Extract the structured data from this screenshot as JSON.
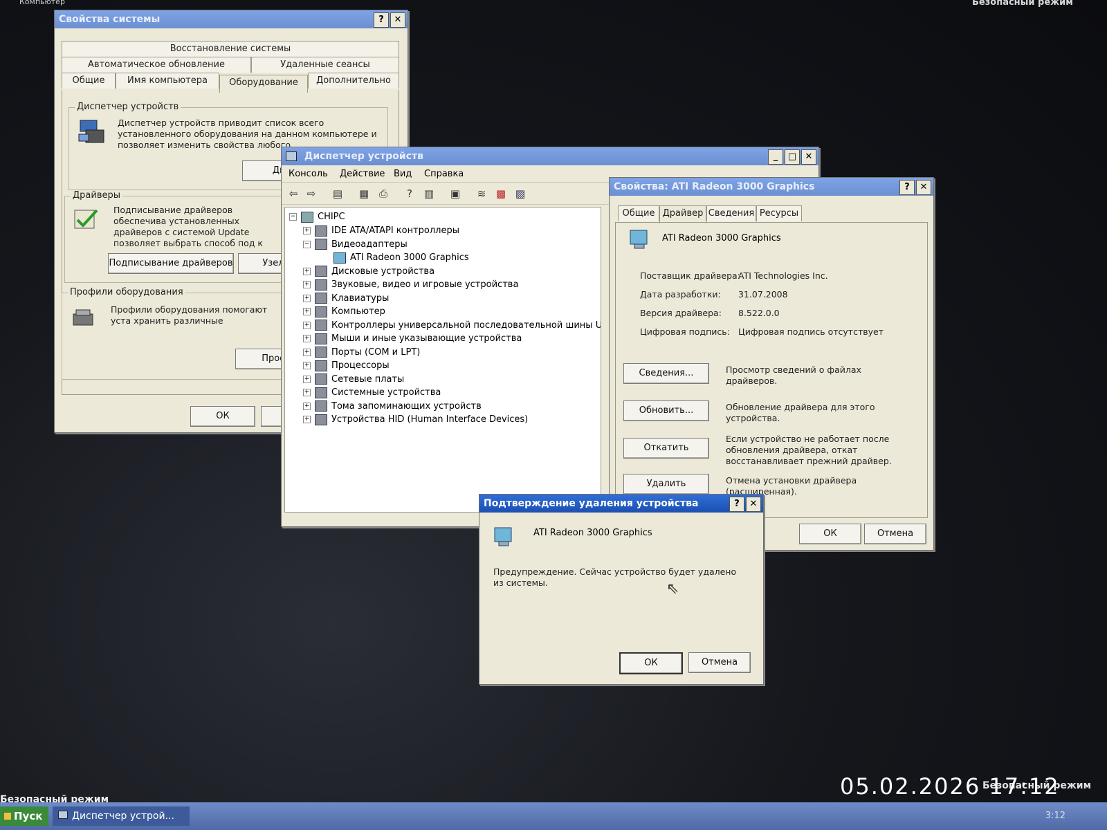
{
  "desktop": {
    "top_left_text": "Компьютер",
    "safe_mode_top": "Безопасный режим",
    "safe_mode_bottom": "Безопасный режим",
    "safe_mode_bottom_right": "Безопасный режим",
    "photo_timestamp": "05.02.2026 17:12"
  },
  "sysprops": {
    "title": "Свойства системы",
    "tabs_row1": [
      "Восстановление системы"
    ],
    "tabs_row2": [
      "Автоматическое обновление",
      "Удаленные сеансы"
    ],
    "tabs_row3": [
      "Общие",
      "Имя компьютера",
      "Оборудование",
      "Дополнительно"
    ],
    "devmgr_group": "Диспетчер устройств",
    "devmgr_text": "Диспетчер устройств приводит список всего установленного оборудования на данном компьютере и позволяет изменить свойства любого",
    "devmgr_button": "Дисп",
    "drivers_group": "Драйверы",
    "drivers_text": "Подписывание драйверов обеспечива установленных драйверов с системой Update позволяет выбрать способ под к Windows Update для поиска драйвер",
    "driver_signing_button": "Подписывание драйверов",
    "windows_update_button": "Узел",
    "profiles_group": "Профили оборудования",
    "profiles_text": "Профили оборудования помогают уста хранить различные конфигурации обо",
    "profiles_button": "Профи",
    "ok": "ОК",
    "cancel": "С"
  },
  "devmgr": {
    "title": "Диспетчер устройств",
    "menu": [
      "Консоль",
      "Действие",
      "Вид",
      "Справка"
    ],
    "tree": {
      "root": "CHIPC",
      "items": [
        {
          "label": "IDE ATA/ATAPI контроллеры",
          "exp": "+",
          "level": 1
        },
        {
          "label": "Видеоадаптеры",
          "exp": "−",
          "level": 1
        },
        {
          "label": "ATI Radeon 3000 Graphics",
          "exp": "",
          "level": 2
        },
        {
          "label": "Дисковые устройства",
          "exp": "+",
          "level": 1
        },
        {
          "label": "Звуковые, видео и игровые устройства",
          "exp": "+",
          "level": 1
        },
        {
          "label": "Клавиатуры",
          "exp": "+",
          "level": 1
        },
        {
          "label": "Компьютер",
          "exp": "+",
          "level": 1
        },
        {
          "label": "Контроллеры универсальной последовательной шины USB",
          "exp": "+",
          "level": 1
        },
        {
          "label": "Мыши и иные указывающие устройства",
          "exp": "+",
          "level": 1
        },
        {
          "label": "Порты (COM и LPT)",
          "exp": "+",
          "level": 1
        },
        {
          "label": "Процессоры",
          "exp": "+",
          "level": 1
        },
        {
          "label": "Сетевые платы",
          "exp": "+",
          "level": 1
        },
        {
          "label": "Системные устройства",
          "exp": "+",
          "level": 1
        },
        {
          "label": "Тома запоминающих устройств",
          "exp": "+",
          "level": 1
        },
        {
          "label": "Устройства HID (Human Interface Devices)",
          "exp": "+",
          "level": 1
        }
      ]
    }
  },
  "props": {
    "title": "Свойства: ATI Radeon 3000 Graphics",
    "tabs": [
      "Общие",
      "Драйвер",
      "Сведения",
      "Ресурсы"
    ],
    "device_name": "ATI Radeon 3000 Graphics",
    "rows": [
      {
        "label": "Поставщик драйвера:",
        "value": "ATI Technologies Inc."
      },
      {
        "label": "Дата разработки:",
        "value": "31.07.2008"
      },
      {
        "label": "Версия драйвера:",
        "value": "8.522.0.0"
      },
      {
        "label": "Цифровая подпись:",
        "value": "Цифровая подпись отсутствует"
      }
    ],
    "actions": [
      {
        "button": "Сведения...",
        "desc": "Просмотр сведений о файлах драйверов."
      },
      {
        "button": "Обновить...",
        "desc": "Обновление драйвера для этого устройства."
      },
      {
        "button": "Откатить",
        "desc": "Если устройство не работает после обновления драйвера, откат восстанавливает прежний драйвер."
      },
      {
        "button": "Удалить",
        "desc": "Отмена установки драйвера (расширенная)."
      }
    ],
    "ok": "ОК",
    "cancel": "Отмена"
  },
  "confirm": {
    "title": "Подтверждение удаления устройства",
    "device_name": "ATI Radeon 3000 Graphics",
    "warning": "Предупреждение. Сейчас устройство будет удалено из системы.",
    "ok": "ОК",
    "cancel": "Отмена"
  },
  "taskbar": {
    "start": "Пуск",
    "task": "Диспетчер устрой...",
    "clock": "3:12"
  }
}
